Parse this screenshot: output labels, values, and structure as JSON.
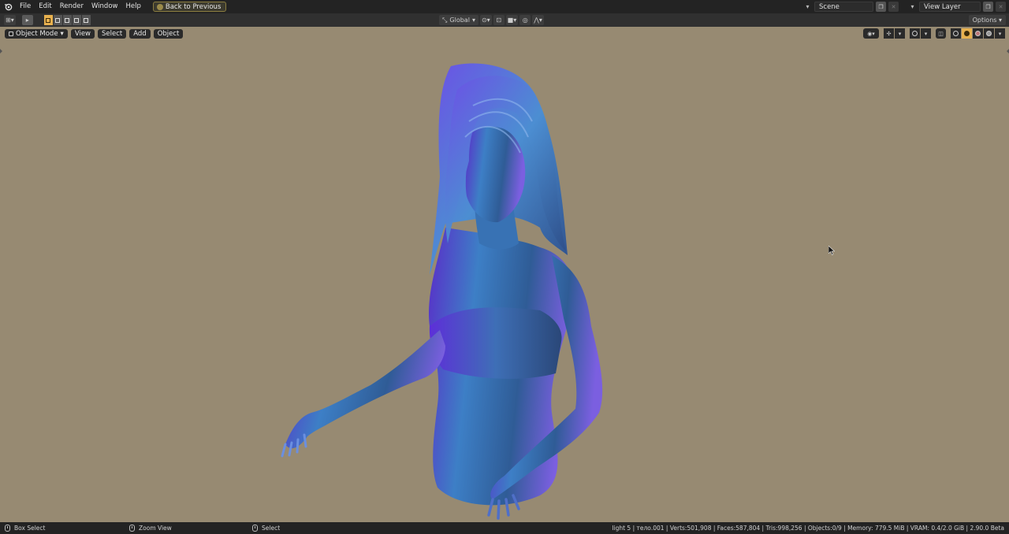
{
  "topbar": {
    "menus": [
      "File",
      "Edit",
      "Render",
      "Window",
      "Help"
    ],
    "back_button": "Back to Previous",
    "scene": "Scene",
    "view_layer": "View Layer"
  },
  "toolheader": {
    "transform_orientation": "Global",
    "options": "Options"
  },
  "viewport": {
    "mode": "Object Mode",
    "menus": [
      "View",
      "Select",
      "Add",
      "Object"
    ],
    "background_color": "#978a72",
    "accent_color": "#e8b14f"
  },
  "statusbar": {
    "left_action": "Box Select",
    "middle_action": "Zoom View",
    "right_action": "Select",
    "stats": "light 5 | тело.001 | Verts:501,908 | Faces:587,804 | Tris:998,256 | Objects:0/9 | Memory: 779.5 MiB | VRAM: 0.4/2.0 GiB | 2.90.0 Beta"
  }
}
